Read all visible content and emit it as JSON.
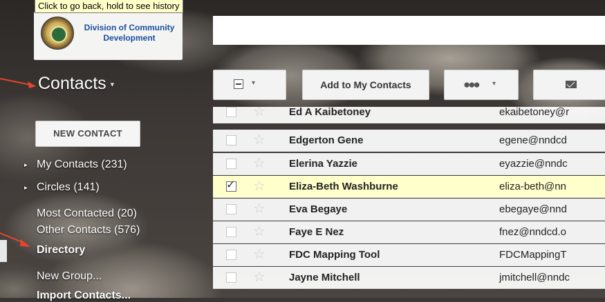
{
  "tooltip": "Click to go back, hold to see history",
  "logo": {
    "line1": "Division of Community",
    "line2": "Development"
  },
  "sidebar": {
    "title": "Contacts",
    "title_caret": "▾",
    "new_contact_label": "NEW CONTACT",
    "items": [
      {
        "label": "My Contacts (231)",
        "expandable": true
      },
      {
        "label": "Circles (141)",
        "expandable": true
      },
      {
        "label": "Most Contacted (20)"
      },
      {
        "label": "Other Contacts (576)"
      },
      {
        "label": "Directory",
        "bold": true
      },
      {
        "label": "New Group..."
      },
      {
        "label": "Import Contacts..."
      }
    ]
  },
  "toolbar": {
    "select_caret": "▾",
    "add_label": "Add to My Contacts",
    "group_icon": "••• ",
    "group_caret": "▾",
    "mail_icon": "envelope-icon"
  },
  "contacts": [
    {
      "name": "Ed A Kaibetoney",
      "email": "ekaibetoney@r"
    },
    {
      "name": "Edgerton Gene",
      "email": "egene@nndcd"
    },
    {
      "name": "Elerina Yazzie",
      "email": "eyazzie@nndc"
    },
    {
      "name": "Eliza-Beth Washburne",
      "email": "eliza-beth@nn",
      "selected": true
    },
    {
      "name": "Eva Begaye",
      "email": "ebegaye@nnd"
    },
    {
      "name": "Faye E Nez",
      "email": "fnez@nndcd.o"
    },
    {
      "name": "FDC Mapping Tool",
      "email": "FDCMappingT"
    },
    {
      "name": "Jayne Mitchell",
      "email": "jmitchell@nndc"
    }
  ],
  "glyphs": {
    "star": "☆",
    "check": "✓",
    "tri": "▸"
  },
  "colors": {
    "arrow": "#e8452c",
    "selected_row": "#ffffcc",
    "logo_text": "#1b4ea0"
  }
}
